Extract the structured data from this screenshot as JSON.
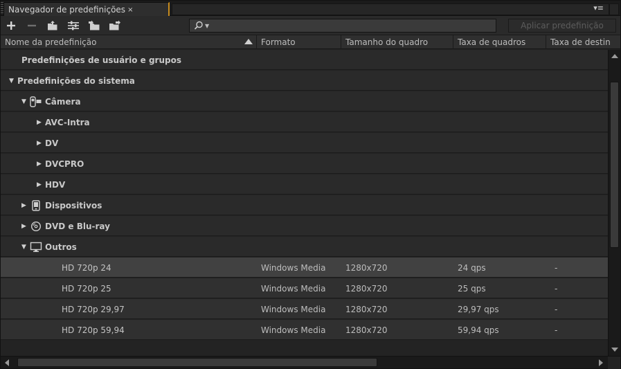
{
  "panel": {
    "tab_title": "Navegador de predefinições",
    "close_glyph": "×",
    "menu_glyph": "▾≡"
  },
  "toolbar": {
    "buttons": [
      "plus-icon",
      "minus-icon",
      "new-group-icon",
      "settings-icon",
      "import-icon",
      "export-icon"
    ],
    "search_placeholder": "",
    "apply_label": "Aplicar predefinição"
  },
  "columns": [
    "Nome da predefinição",
    "Formato",
    "Tamanho do quadro",
    "Taxa de quadros",
    "Taxa de destin"
  ],
  "rows": [
    {
      "kind": "grp",
      "label": "Predefinições de usuário e grupos",
      "tri": "",
      "icon": ""
    },
    {
      "kind": "grp",
      "label": "Predefinições do sistema",
      "tri": "▼",
      "icon": ""
    },
    {
      "kind": "grp",
      "label": "Câmera",
      "tri": "▼",
      "icon": "camera-icon"
    },
    {
      "kind": "grp",
      "label": "AVC-Intra",
      "tri": "▶",
      "icon": ""
    },
    {
      "kind": "grp",
      "label": "DV",
      "tri": "▶",
      "icon": ""
    },
    {
      "kind": "grp",
      "label": "DVCPRO",
      "tri": "▶",
      "icon": ""
    },
    {
      "kind": "grp",
      "label": "HDV",
      "tri": "▶",
      "icon": ""
    },
    {
      "kind": "grp",
      "label": "Dispositivos",
      "tri": "▶",
      "icon": "device-icon"
    },
    {
      "kind": "grp",
      "label": "DVD e Blu-ray",
      "tri": "▶",
      "icon": "disc-icon"
    },
    {
      "kind": "grp",
      "label": "Outros",
      "tri": "▼",
      "icon": "monitor-icon"
    },
    {
      "kind": "leaf",
      "label": "HD 720p 24",
      "format": "Windows Media",
      "size": "1280x720",
      "rate": "24 qps",
      "target": "-",
      "selected": true
    },
    {
      "kind": "leaf",
      "label": "HD 720p 25",
      "format": "Windows Media",
      "size": "1280x720",
      "rate": "25 qps",
      "target": "-",
      "selected": false
    },
    {
      "kind": "leaf",
      "label": "HD 720p 29,97",
      "format": "Windows Media",
      "size": "1280x720",
      "rate": "29,97 qps",
      "target": "-",
      "selected": false
    },
    {
      "kind": "leaf",
      "label": "HD 720p 59,94",
      "format": "Windows Media",
      "size": "1280x720",
      "rate": "59,94 qps",
      "target": "-",
      "selected": false
    }
  ]
}
